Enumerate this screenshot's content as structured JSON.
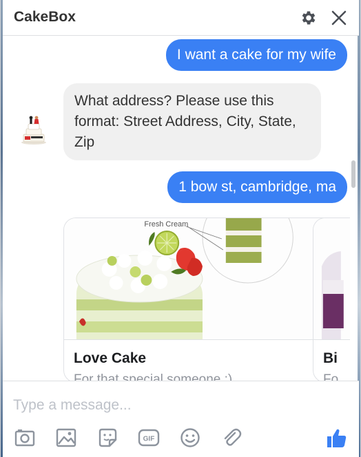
{
  "header": {
    "title": "CakeBox",
    "icons": [
      "gear-icon",
      "close-icon"
    ]
  },
  "messages": [
    {
      "from": "user",
      "text": "I want a cake for my wife"
    },
    {
      "from": "bot",
      "text": "What address? Please use this format: Street Address, City, State, Zip"
    },
    {
      "from": "user",
      "text": "1 bow st, cambridge, ma"
    }
  ],
  "cards": [
    {
      "title": "Love Cake",
      "subtitle": "For that special someone :)",
      "image_label": "Fresh Cream"
    },
    {
      "title": "Bi",
      "subtitle": "Fo"
    }
  ],
  "composer": {
    "placeholder": "Type a message...",
    "tools": [
      "camera-icon",
      "image-icon",
      "sticker-icon",
      "gif-icon",
      "emoji-icon",
      "attachment-icon",
      "thumbs-up-icon"
    ],
    "gif_label": "GIF"
  },
  "colors": {
    "accent": "#3a80f4",
    "bubble_in": "#f0f0f0",
    "icon_gray": "#8d949e",
    "header_text": "#333333"
  }
}
